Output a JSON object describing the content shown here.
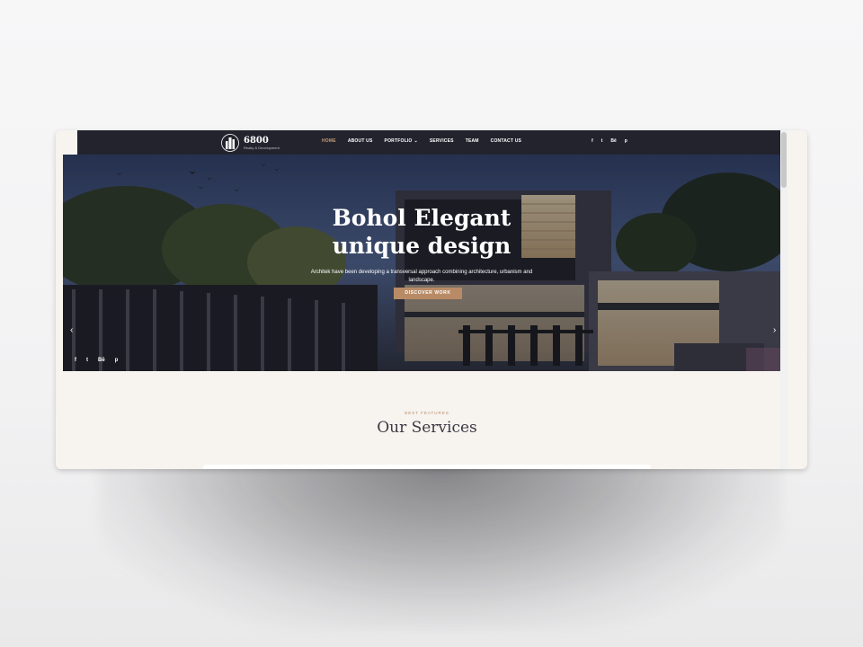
{
  "brand": {
    "name": "6800",
    "tagline": "Realty & Development"
  },
  "nav": {
    "items": [
      {
        "label": "HOME",
        "active": true
      },
      {
        "label": "ABOUT US"
      },
      {
        "label": "PORTFOLIO",
        "dropdown": true
      },
      {
        "label": "SERVICES"
      },
      {
        "label": "TEAM"
      },
      {
        "label": "CONTACT US"
      }
    ]
  },
  "social": [
    "f",
    "t",
    "Bē",
    "p"
  ],
  "hero": {
    "title_line1": "Bohol Elegant",
    "title_line2": "unique design",
    "description": "Architek have been developing a transversal approach combining architecture, urbanism and landscape.",
    "button": "DISCOVER WORK"
  },
  "services": {
    "eyebrow": "BEST FEATURES",
    "title": "Our Services"
  },
  "colors": {
    "header": "#23232e",
    "accent": "#c79b76",
    "button": "#b88b66",
    "section_bg": "#f7f3ef"
  },
  "icons": {
    "facebook": "facebook-icon",
    "twitter": "twitter-icon",
    "behance": "behance-icon",
    "pinterest": "pinterest-icon",
    "prev": "chevron-left-icon",
    "next": "chevron-right-icon"
  }
}
